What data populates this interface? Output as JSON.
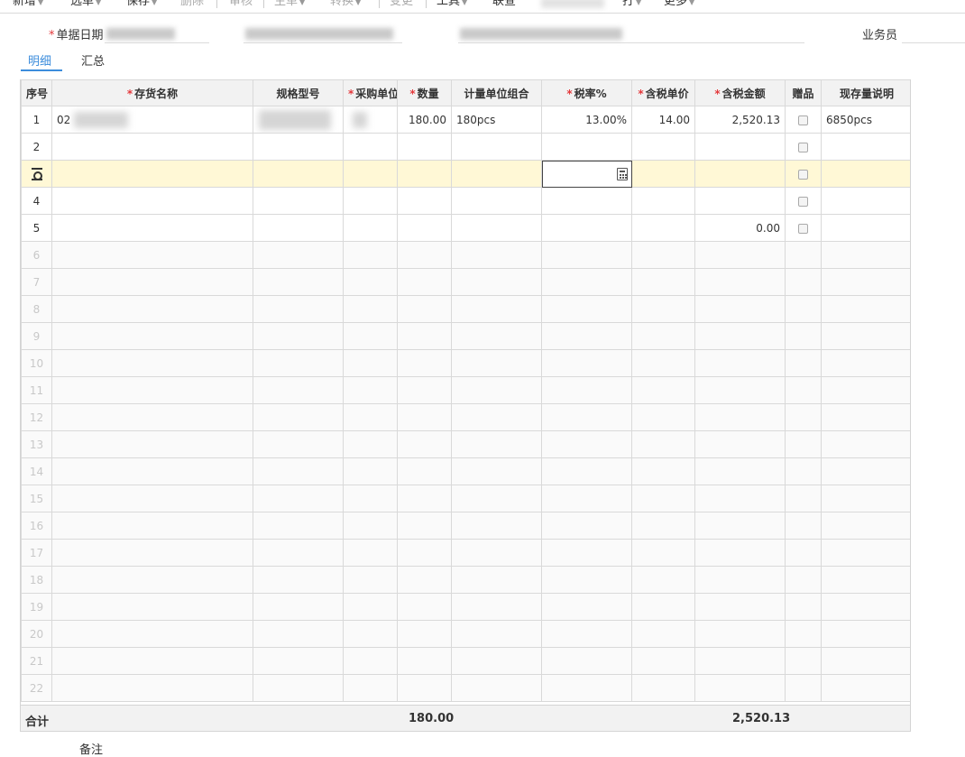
{
  "toolbar": {
    "items": [
      "新增",
      "选单",
      "保存",
      "删除",
      "审核",
      "生单",
      "转换",
      "变更",
      "工具",
      "联查",
      "打",
      "更多"
    ]
  },
  "form": {
    "date_label": "单据日期",
    "salesperson_label": "业务员"
  },
  "tabs": [
    "明细",
    "汇总"
  ],
  "columns": [
    "序号",
    "存货名称",
    "规格型号",
    "采购单位",
    "数量",
    "计量单位组合",
    "税率%",
    "含税单价",
    "含税金额",
    "赠品",
    "现存量说明"
  ],
  "required_columns": [
    "存货名称",
    "采购单位",
    "数量",
    "税率%",
    "含税单价",
    "含税金额"
  ],
  "rows": [
    {
      "idx": "1",
      "name": "02",
      "spec": "",
      "unit": "",
      "qty": "180.00",
      "uom_group": "180pcs",
      "tax_rate": "13.00%",
      "unit_price": "14.00",
      "amount": "2,520.13",
      "stock_note": "6850pcs"
    },
    {
      "idx": "2",
      "name": "",
      "spec": "",
      "unit": "",
      "qty": "",
      "uom_group": "",
      "tax_rate": "",
      "unit_price": "",
      "amount": "",
      "stock_note": ""
    },
    {
      "idx": "",
      "name": "",
      "spec": "",
      "unit": "",
      "qty": "",
      "uom_group": "",
      "tax_rate": "",
      "unit_price": "",
      "amount": "",
      "stock_note": ""
    },
    {
      "idx": "4",
      "name": "",
      "spec": "",
      "unit": "",
      "qty": "",
      "uom_group": "",
      "tax_rate": "",
      "unit_price": "",
      "amount": "",
      "stock_note": ""
    },
    {
      "idx": "5",
      "name": "",
      "spec": "",
      "unit": "",
      "qty": "",
      "uom_group": "",
      "tax_rate": "",
      "unit_price": "",
      "amount": "0.00",
      "stock_note": ""
    }
  ],
  "empty_rows": [
    "6",
    "7",
    "8",
    "9",
    "10",
    "11",
    "12",
    "13",
    "14",
    "15",
    "16",
    "17",
    "18",
    "19",
    "20",
    "21",
    "22"
  ],
  "totals": {
    "label": "合计",
    "qty": "180.00",
    "amount": "2,520.13"
  },
  "remark_label": "备注",
  "colors": {
    "accent": "#3c8ddc",
    "required": "#e4393c",
    "active_row": "#fff8d6",
    "header_bg": "#f2f2f2"
  },
  "icons": {
    "row_settings": "gear-icon",
    "calculator": "calculator-icon"
  }
}
